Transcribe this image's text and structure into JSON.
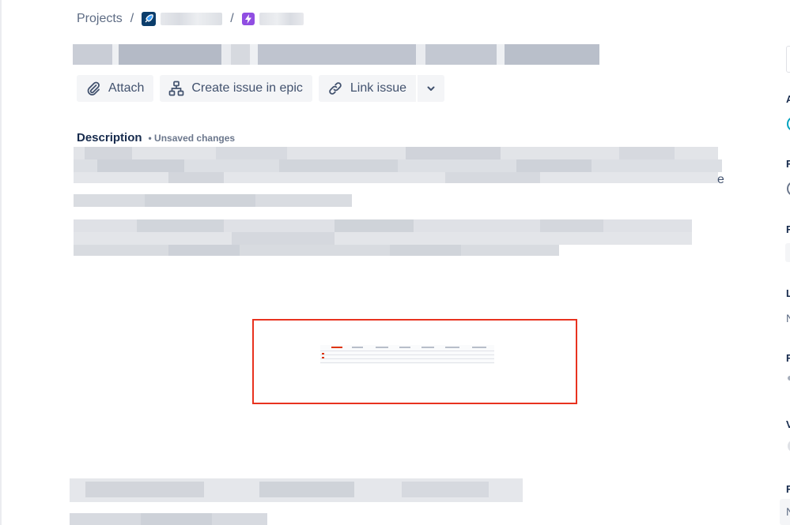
{
  "breadcrumb": {
    "projects_label": "Projects",
    "separator": "/"
  },
  "toolbar": {
    "attach_label": "Attach",
    "create_issue_label": "Create issue in epic",
    "link_issue_label": "Link issue"
  },
  "description": {
    "title": "Description",
    "unsaved_label": "• Unsaved changes"
  },
  "right_rail": {
    "labels": [
      "A",
      "F",
      "F",
      "L",
      "F",
      "V",
      "F"
    ],
    "values": [
      "N",
      "N"
    ]
  },
  "colors": {
    "accent": "#0052cc",
    "project_avatar": "#0b3d6b",
    "epic": "#904ee2",
    "highlight_box": "#e8321f"
  }
}
